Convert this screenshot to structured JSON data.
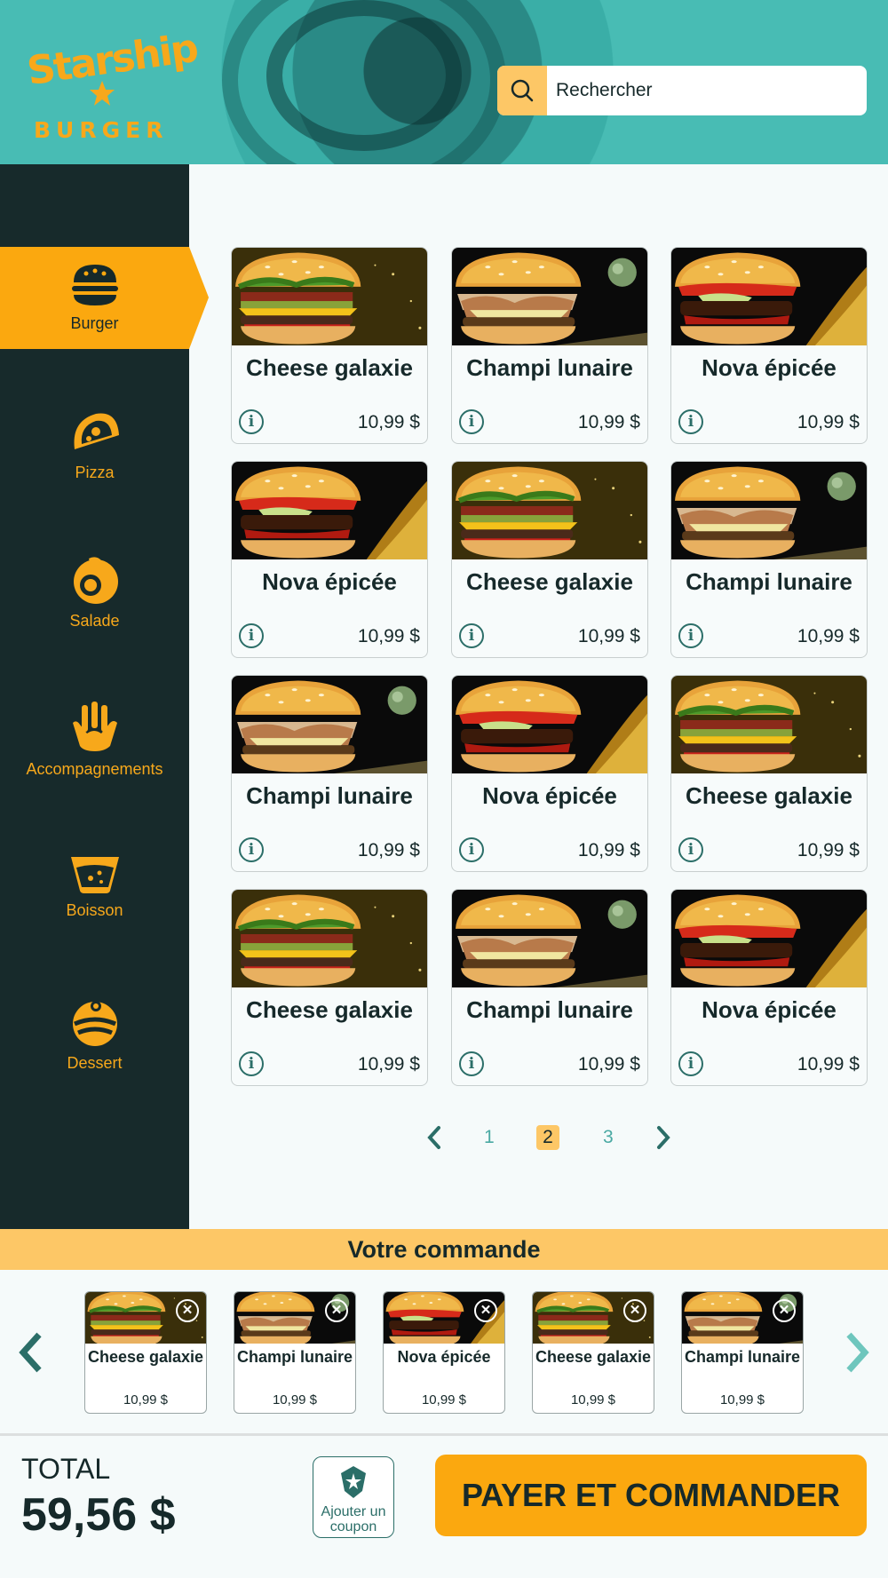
{
  "brand": {
    "logo_top": "Starship",
    "logo_bottom": "BURGER"
  },
  "search": {
    "placeholder": "Rechercher"
  },
  "sidebar": {
    "items": [
      {
        "label": "Burger",
        "icon": "burger-icon",
        "active": true
      },
      {
        "label": "Pizza",
        "icon": "pizza-icon"
      },
      {
        "label": "Salade",
        "icon": "salad-icon"
      },
      {
        "label": "Accompagnements",
        "icon": "fries-icon"
      },
      {
        "label": "Boisson",
        "icon": "drink-icon"
      },
      {
        "label": "Dessert",
        "icon": "dessert-icon"
      }
    ]
  },
  "products": [
    {
      "name": "Cheese galaxie",
      "price": "10,99 $",
      "kind": "cheese"
    },
    {
      "name": "Champi lunaire",
      "price": "10,99 $",
      "kind": "champi"
    },
    {
      "name": "Nova épicée",
      "price": "10,99 $",
      "kind": "nova"
    },
    {
      "name": "Nova épicée",
      "price": "10,99 $",
      "kind": "nova"
    },
    {
      "name": "Cheese galaxie",
      "price": "10,99 $",
      "kind": "cheese"
    },
    {
      "name": "Champi lunaire",
      "price": "10,99 $",
      "kind": "champi"
    },
    {
      "name": "Champi lunaire",
      "price": "10,99 $",
      "kind": "champi"
    },
    {
      "name": "Nova épicée",
      "price": "10,99 $",
      "kind": "nova"
    },
    {
      "name": "Cheese galaxie",
      "price": "10,99 $",
      "kind": "cheese"
    },
    {
      "name": "Cheese galaxie",
      "price": "10,99 $",
      "kind": "cheese"
    },
    {
      "name": "Champi lunaire",
      "price": "10,99 $",
      "kind": "champi"
    },
    {
      "name": "Nova épicée",
      "price": "10,99 $",
      "kind": "nova"
    }
  ],
  "pagination": {
    "pages": [
      "1",
      "2",
      "3"
    ],
    "current": "2"
  },
  "order": {
    "title": "Votre commande",
    "items": [
      {
        "name": "Cheese galaxie",
        "price": "10,99 $",
        "kind": "cheese"
      },
      {
        "name": "Champi lunaire",
        "price": "10,99 $",
        "kind": "champi"
      },
      {
        "name": "Nova épicée",
        "price": "10,99 $",
        "kind": "nova"
      },
      {
        "name": "Cheese galaxie",
        "price": "10,99 $",
        "kind": "cheese"
      },
      {
        "name": "Champi lunaire",
        "price": "10,99 $",
        "kind": "champi"
      }
    ]
  },
  "footer": {
    "total_label": "TOTAL",
    "total_value": "59,56 $",
    "coupon_label": "Ajouter un coupon",
    "pay_label": "PAYER ET COMMANDER"
  },
  "colors": {
    "accent": "#fba80f",
    "accent_light": "#fdc766",
    "dark": "#172a2b",
    "teal": "#2b6e68"
  }
}
